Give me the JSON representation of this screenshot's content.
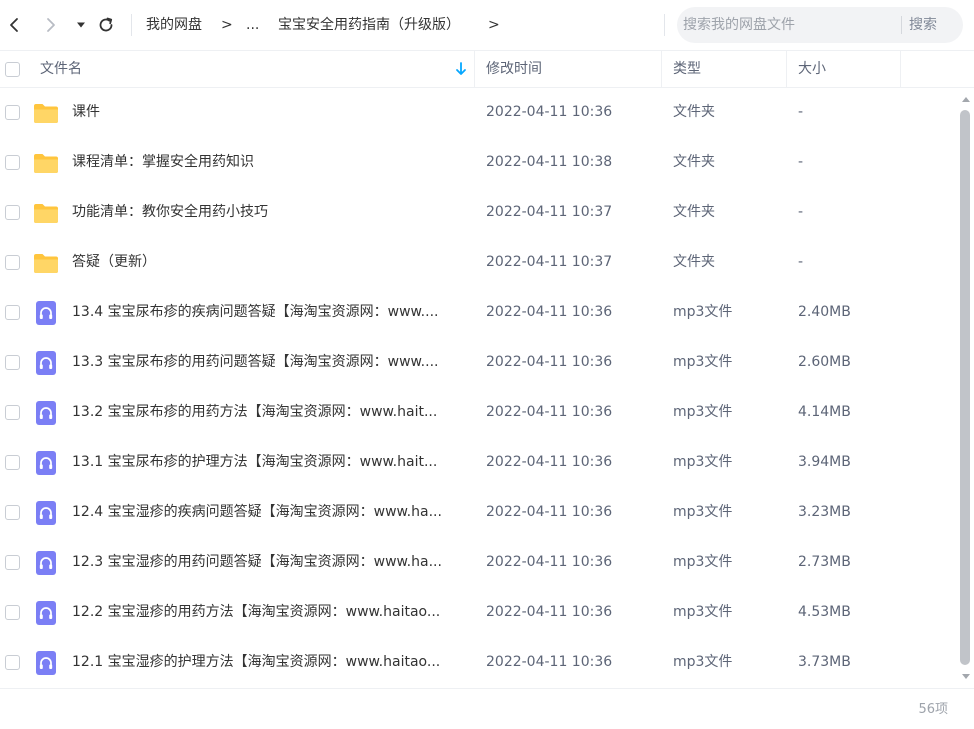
{
  "nav": {
    "back_icon": "chevron-left-icon",
    "forward_icon": "chevron-right-icon",
    "dropdown_icon": "caret-down-icon",
    "refresh_icon": "refresh-icon"
  },
  "breadcrumb": {
    "root": "我的网盘",
    "sep1": ">",
    "ellipsis": "...",
    "current": "宝宝安全用药指南（升级版）",
    "sep2": ">"
  },
  "search": {
    "placeholder": "搜索我的网盘文件",
    "button_label": "搜索"
  },
  "table": {
    "headers": {
      "name": "文件名",
      "modified": "修改时间",
      "type": "类型",
      "size": "大小"
    },
    "sort_icon": "arrow-down-icon",
    "rows": [
      {
        "kind": "folder",
        "name": "课件",
        "modified": "2022-04-11 10:36",
        "type": "文件夹",
        "size": "-"
      },
      {
        "kind": "folder",
        "name": "课程清单：掌握安全用药知识",
        "modified": "2022-04-11 10:38",
        "type": "文件夹",
        "size": "-"
      },
      {
        "kind": "folder",
        "name": "功能清单：教你安全用药小技巧",
        "modified": "2022-04-11 10:37",
        "type": "文件夹",
        "size": "-"
      },
      {
        "kind": "folder",
        "name": "答疑（更新）",
        "modified": "2022-04-11 10:37",
        "type": "文件夹",
        "size": "-"
      },
      {
        "kind": "audio",
        "name": "13.4 宝宝尿布疹的疾病问题答疑【海淘宝资源网：www....",
        "modified": "2022-04-11 10:36",
        "type": "mp3文件",
        "size": "2.40MB"
      },
      {
        "kind": "audio",
        "name": "13.3 宝宝尿布疹的用药问题答疑【海淘宝资源网：www....",
        "modified": "2022-04-11 10:36",
        "type": "mp3文件",
        "size": "2.60MB"
      },
      {
        "kind": "audio",
        "name": "13.2 宝宝尿布疹的用药方法【海淘宝资源网：www.hait...",
        "modified": "2022-04-11 10:36",
        "type": "mp3文件",
        "size": "4.14MB"
      },
      {
        "kind": "audio",
        "name": "13.1 宝宝尿布疹的护理方法【海淘宝资源网：www.hait...",
        "modified": "2022-04-11 10:36",
        "type": "mp3文件",
        "size": "3.94MB"
      },
      {
        "kind": "audio",
        "name": "12.4 宝宝湿疹的疾病问题答疑【海淘宝资源网：www.ha...",
        "modified": "2022-04-11 10:36",
        "type": "mp3文件",
        "size": "3.23MB"
      },
      {
        "kind": "audio",
        "name": "12.3 宝宝湿疹的用药问题答疑【海淘宝资源网：www.ha...",
        "modified": "2022-04-11 10:36",
        "type": "mp3文件",
        "size": "2.73MB"
      },
      {
        "kind": "audio",
        "name": "12.2 宝宝湿疹的用药方法【海淘宝资源网：www.haitao...",
        "modified": "2022-04-11 10:36",
        "type": "mp3文件",
        "size": "4.53MB"
      },
      {
        "kind": "audio",
        "name": "12.1 宝宝湿疹的护理方法【海淘宝资源网：www.haitao...",
        "modified": "2022-04-11 10:36",
        "type": "mp3文件",
        "size": "3.73MB"
      }
    ]
  },
  "footer": {
    "count": "56项"
  },
  "colors": {
    "folder": "#ffc53d",
    "audio": "#7b7ff5",
    "accent": "#06a7ff"
  }
}
